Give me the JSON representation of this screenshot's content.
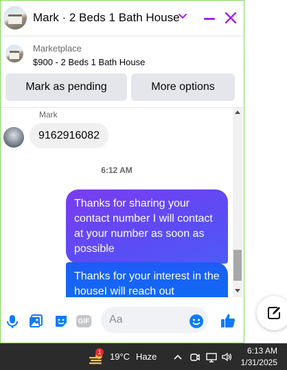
{
  "header": {
    "title": "Mark · 2 Beds 1 Bath House",
    "accent": "#a020f0"
  },
  "listing": {
    "source": "Marketplace",
    "price_title": "$900 - 2 Beds 1 Bath House",
    "pending_label": "Mark as pending",
    "more_label": "More options"
  },
  "messages": {
    "sender_name": "Mark",
    "incoming_text": "9162916082",
    "time": "6:12 AM",
    "outgoing": [
      "Thanks for sharing your contact number I will contact at your number as soon as possible",
      "Thanks for your interest in the houseI will reach out"
    ]
  },
  "composer": {
    "placeholder": "Aa",
    "gif_label": "GIF"
  },
  "taskbar": {
    "weather_badge": "1",
    "temperature": "19°C",
    "condition": "Haze",
    "time": "6:13 AM",
    "date": "1/31/2025"
  }
}
